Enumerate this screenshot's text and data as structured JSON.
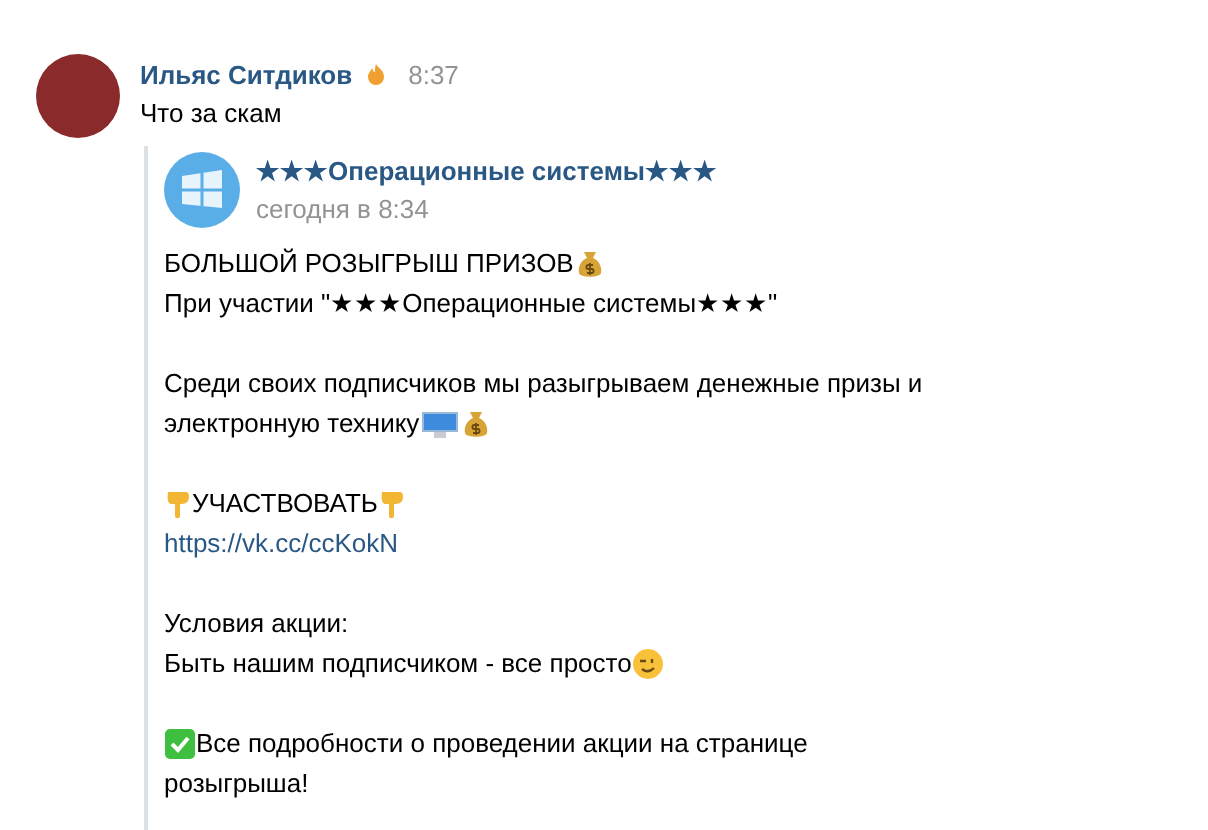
{
  "message": {
    "author": "Ильяс Ситдиков",
    "time": "8:37",
    "text": "Что за скам"
  },
  "repost": {
    "group_name": "★★★Операционные системы★★★",
    "date": "сегодня в 8:34",
    "paragraphs": [
      [
        [
          {
            "kind": "text",
            "text": "БОЛЬШОЙ РОЗЫГРЫШ ПРИЗОВ"
          },
          {
            "kind": "money"
          }
        ],
        [
          {
            "kind": "text",
            "text": "При участии \"★★★Операционные системы★★★\""
          }
        ]
      ],
      [
        [
          {
            "kind": "text",
            "text": "Среди своих подписчиков мы разыгрываем денежные призы и"
          }
        ],
        [
          {
            "kind": "text",
            "text": "электронную технику"
          },
          {
            "kind": "computer"
          },
          {
            "kind": "money"
          }
        ]
      ],
      [
        [
          {
            "kind": "point-down"
          },
          {
            "kind": "text",
            "text": "УЧАСТВОВАТЬ"
          },
          {
            "kind": "point-down"
          }
        ],
        [
          {
            "kind": "link",
            "text": "https://vk.cc/ccKokN"
          }
        ]
      ],
      [
        [
          {
            "kind": "text",
            "text": "Условия акции:"
          }
        ],
        [
          {
            "kind": "text",
            "text": "Быть нашим подписчиком - все просто"
          },
          {
            "kind": "wink"
          }
        ]
      ],
      [
        [
          {
            "kind": "check"
          },
          {
            "kind": "text",
            "text": "Все подробности о проведении акции на странице"
          }
        ],
        [
          {
            "kind": "text",
            "text": "розыгрыша!"
          }
        ]
      ]
    ]
  }
}
